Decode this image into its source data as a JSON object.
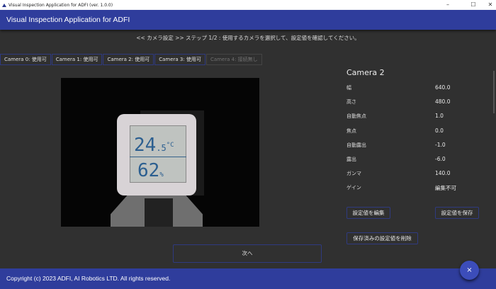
{
  "window": {
    "title": "Visual Inspection Application for ADFI (ver. 1.0.0)",
    "minimize": "–",
    "maximize": "☐",
    "close": "✕"
  },
  "appbar": {
    "title": "Visual Inspection Application for ADFI"
  },
  "instruction": "<< カメラ設定 >> ステップ 1/2 : 使用するカメラを選択して、設定値を確認してください。",
  "tabs": [
    {
      "label": "Camera 0: 使用可",
      "enabled": true
    },
    {
      "label": "Camera 1: 使用可",
      "enabled": true
    },
    {
      "label": "Camera 2: 使用可",
      "enabled": true
    },
    {
      "label": "Camera 3: 使用可",
      "enabled": true
    },
    {
      "label": "Camera 4: 接続無し",
      "enabled": false
    }
  ],
  "preview": {
    "temperature": "24",
    "temperature_decimal": ".5",
    "temperature_unit": "°C",
    "humidity": "62",
    "humidity_unit": "%"
  },
  "panel": {
    "title": "Camera 2",
    "settings": [
      {
        "label": "幅",
        "value": "640.0"
      },
      {
        "label": "高さ",
        "value": "480.0"
      },
      {
        "label": "自動焦点",
        "value": "1.0"
      },
      {
        "label": "焦点",
        "value": "0.0"
      },
      {
        "label": "自動露出",
        "value": "-1.0"
      },
      {
        "label": "露出",
        "value": "-6.0"
      },
      {
        "label": "ガンマ",
        "value": "140.0"
      },
      {
        "label": "ゲイン",
        "value": "編集不可"
      }
    ],
    "edit_button": "設定値を編集",
    "save_button": "設定値を保存",
    "delete_button": "保存済みの設定値を削除"
  },
  "next_button": "次へ",
  "footer": "Copyright (c) 2023 ADFI, AI Robotics LTD. All rights reserved.",
  "fab_icon": "close-icon",
  "fab_label": "×",
  "colors": {
    "primary": "#2f3d9c",
    "background": "#303030",
    "fab": "#3c4dba"
  }
}
